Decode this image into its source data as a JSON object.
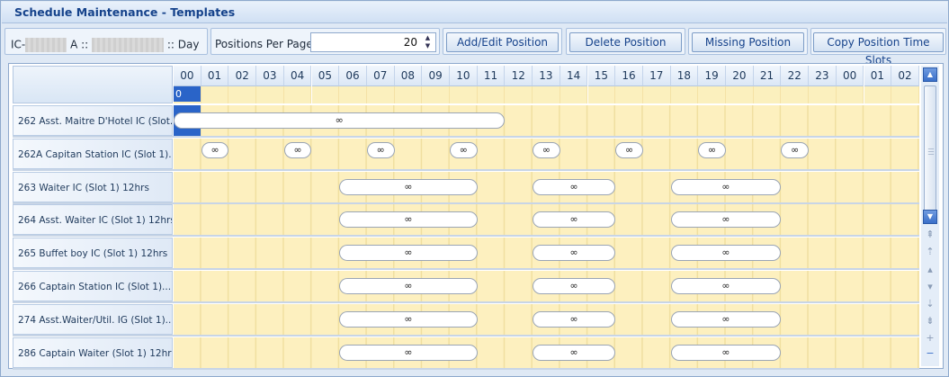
{
  "window": {
    "title": "Schedule Maintenance - Templates"
  },
  "toolbar": {
    "context_prefix": "IC-",
    "context_mid": "A ::",
    "context_suffix": ":: Day",
    "positions_per_page_label": "Positions Per Page",
    "positions_per_page_value": "20",
    "buttons": {
      "add_edit": "Add/Edit Position",
      "delete": "Delete Position",
      "missing": "Missing Position",
      "copy": "Copy Position Time Slots"
    }
  },
  "grid": {
    "hours": [
      "00",
      "01",
      "02",
      "03",
      "04",
      "05",
      "06",
      "07",
      "08",
      "09",
      "10",
      "11",
      "12",
      "13",
      "14",
      "15",
      "16",
      "17",
      "18",
      "19",
      "20",
      "21",
      "22",
      "23",
      "00",
      "01",
      "02"
    ],
    "selected_cell_value": "0",
    "shift_symbol": "∞",
    "rows": [
      {
        "label": "262 Asst. Maitre D'Hotel IC (Slot...",
        "shifts": [
          {
            "start": 0,
            "end": 12
          }
        ]
      },
      {
        "label": "262A Capitan Station IC (Slot 1)...",
        "shifts": [
          {
            "start": 1,
            "end": 2
          },
          {
            "start": 4,
            "end": 5
          },
          {
            "start": 7,
            "end": 8
          },
          {
            "start": 10,
            "end": 11
          },
          {
            "start": 13,
            "end": 14
          },
          {
            "start": 16,
            "end": 17
          },
          {
            "start": 19,
            "end": 20
          },
          {
            "start": 22,
            "end": 23
          }
        ]
      },
      {
        "label": "263 Waiter IC (Slot 1) 12hrs",
        "shifts": [
          {
            "start": 6,
            "end": 11
          },
          {
            "start": 13,
            "end": 16
          },
          {
            "start": 18,
            "end": 22
          }
        ]
      },
      {
        "label": "264 Asst. Waiter IC (Slot 1) 12hrs",
        "shifts": [
          {
            "start": 6,
            "end": 11
          },
          {
            "start": 13,
            "end": 16
          },
          {
            "start": 18,
            "end": 22
          }
        ]
      },
      {
        "label": "265 Buffet boy IC (Slot 1) 12hrs",
        "shifts": [
          {
            "start": 6,
            "end": 11
          },
          {
            "start": 13,
            "end": 16
          },
          {
            "start": 18,
            "end": 22
          }
        ]
      },
      {
        "label": "266 Captain Station IC (Slot 1)...",
        "shifts": [
          {
            "start": 6,
            "end": 11
          },
          {
            "start": 13,
            "end": 16
          },
          {
            "start": 18,
            "end": 22
          }
        ]
      },
      {
        "label": "274 Asst.Waiter/Util. IG (Slot 1)...",
        "shifts": [
          {
            "start": 6,
            "end": 11
          },
          {
            "start": 13,
            "end": 16
          },
          {
            "start": 18,
            "end": 22
          }
        ]
      },
      {
        "label": "286 Captain Waiter (Slot 1) 12hrs",
        "shifts": [
          {
            "start": 6,
            "end": 11
          },
          {
            "start": 13,
            "end": 16
          },
          {
            "start": 18,
            "end": 22
          }
        ]
      }
    ]
  }
}
